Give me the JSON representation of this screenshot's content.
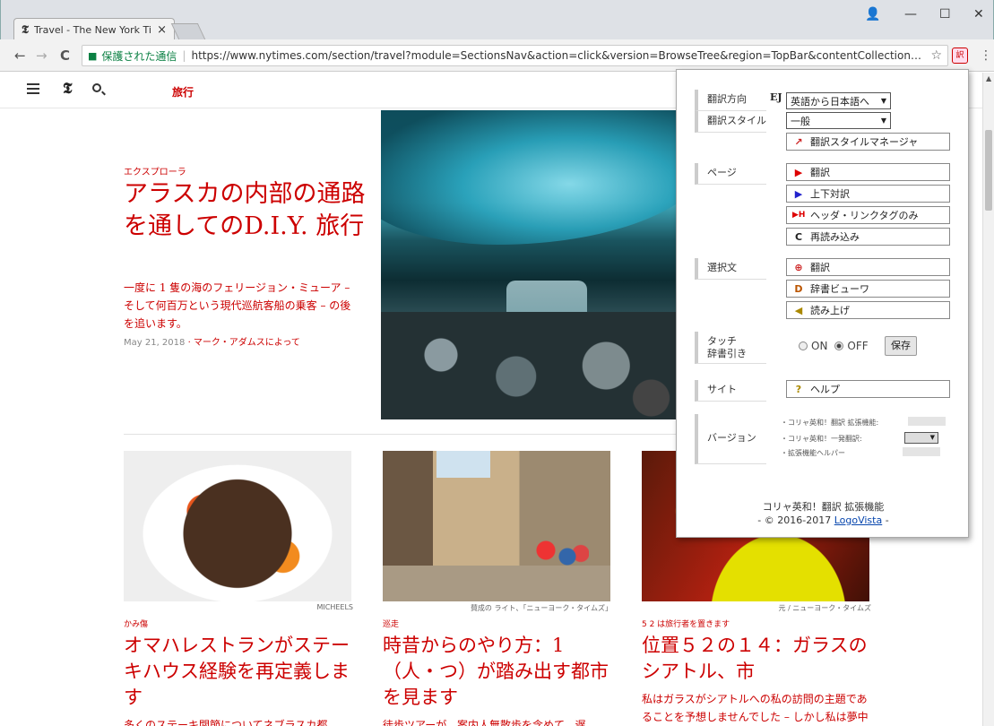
{
  "browser": {
    "tab_title": "Travel - The New York Tim",
    "tab_close": "×",
    "favicon": "𝕿",
    "win_account": "👤",
    "win_minimize": "—",
    "win_maximize": "☐",
    "win_close": "✕",
    "back": "←",
    "forward": "→",
    "reload": "C",
    "secure_label": "保護された通信",
    "url": "https://www.nytimes.com/section/travel?module=SectionsNav&action=click&version=BrowseTree&region=TopBar&contentCollection=Travel&pgtype...",
    "star": "☆",
    "menu": "⋮"
  },
  "nyt": {
    "logo": "𝕿",
    "section": "旅行",
    "lead": {
      "kicker": "エクスプローラ",
      "title": "アラスカの内部の通路を通してのD.I.Y. 旅行",
      "summary": "一度に 1 隻の海のフェリージョン・ミューア – そして何百万という現代巡航客船の乗客 – の後を追います。",
      "date": "May 21, 2018",
      "byline": " · マーク・アダムスによって"
    },
    "cards": [
      {
        "credit": "MICHEELS",
        "kicker": "かみ傷",
        "title": "オマハレストランがステーキハウス経験を再定義します",
        "summary": "多くのステーキ関節についてネブラスカ都"
      },
      {
        "credit": "賛成の ライト、「ニューヨーク・タイムズ」",
        "kicker": "巡走",
        "title": "時昔からのやり方：1（人・つ）が踏み出す都市を見ます",
        "summary": "徒歩ツアーが、案内人無散歩を含めて、遅"
      },
      {
        "credit": "元 / ニューヨーク・タイムズ",
        "kicker": "5 2 は旅行者を置きます",
        "title": "位置５２の１４：ガラスのシアトル、市",
        "summary": "私はガラスがシアトルへの私の訪問の主題であることを予想しませんでした – しかし私は夢中にされました。ここにそれに只無"
      }
    ]
  },
  "popup": {
    "direction_label": "翻訳方向",
    "direction_badge": "EJ",
    "direction_value": "英語から日本語へ",
    "style_label": "翻訳スタイル",
    "style_value": "一般",
    "style_manager": "翻訳スタイルマネージャ",
    "page_label": "ページ",
    "page_buttons": [
      "翻訳",
      "上下対訳",
      "ヘッダ・リンクタグのみ",
      "再読み込み"
    ],
    "selection_label": "選択文",
    "selection_buttons": [
      "翻訳",
      "辞書ビューワ",
      "読み上げ"
    ],
    "touch_label": "タッチ\n辞書引き",
    "on_label": "ON",
    "off_label": "OFF",
    "save_label": "保存",
    "site_label": "サイト",
    "help_label": "ヘルプ",
    "version_label": "バージョン",
    "version_lines": [
      "・コリャ英和！翻訳 拡張機能:",
      "・コリャ英和！一発翻訳:",
      "・拡張機能ヘルパー"
    ],
    "footer_line1": "コリャ英和！翻訳 拡張機能",
    "footer_prefix": "- © 2016-2017 ",
    "footer_link": "LogoVista",
    "footer_suffix": " -"
  }
}
